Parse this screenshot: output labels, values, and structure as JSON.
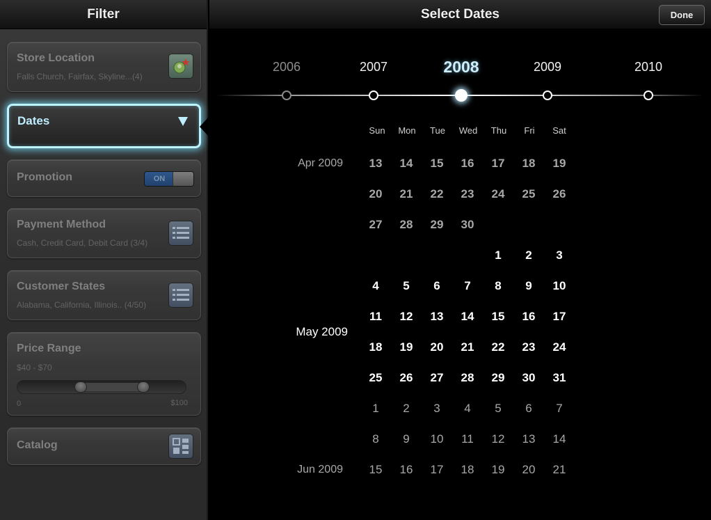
{
  "left": {
    "title": "Filter",
    "cards": {
      "store": {
        "title": "Store Location",
        "sub": "Falls Church, Fairfax, Skyline...(4)",
        "icon": "map-pin-icon"
      },
      "dates": {
        "title": "Dates",
        "icon": "triangle-down-icon"
      },
      "promotion": {
        "title": "Promotion",
        "toggle": "ON"
      },
      "payment": {
        "title": "Payment Method",
        "sub": "Cash, Credit Card, Debit Card (3/4)",
        "icon": "list-icon"
      },
      "states": {
        "title": "Customer States",
        "sub": "Alabama, California, Illinois.. (4/50)",
        "icon": "list-icon"
      },
      "price": {
        "title": "Price Range",
        "sub": "$40 - $70",
        "min": "0",
        "max": "$100"
      },
      "catalog": {
        "title": "Catalog",
        "icon": "catalog-icon"
      }
    }
  },
  "right": {
    "title": "Select Dates",
    "done": "Done",
    "years": [
      "2006",
      "2007",
      "2008",
      "2009",
      "2010"
    ],
    "selected_year": "2008",
    "weekdays": [
      "Sun",
      "Mon",
      "Tue",
      "Wed",
      "Thu",
      "Fri",
      "Sat"
    ],
    "months": [
      "Apr 2009",
      "May 2009",
      "Jun 2009"
    ],
    "weeks": [
      [
        "13",
        "14",
        "15",
        "16",
        "17",
        "18",
        "19"
      ],
      [
        "20",
        "21",
        "22",
        "23",
        "24",
        "25",
        "26"
      ],
      [
        "27",
        "28",
        "29",
        "30",
        "",
        "",
        ""
      ],
      [
        "",
        "",
        "",
        "",
        "1",
        "2",
        "3"
      ],
      [
        "4",
        "5",
        "6",
        "7",
        "8",
        "9",
        "10"
      ],
      [
        "11",
        "12",
        "13",
        "14",
        "15",
        "16",
        "17"
      ],
      [
        "18",
        "19",
        "20",
        "21",
        "22",
        "23",
        "24"
      ],
      [
        "25",
        "26",
        "27",
        "28",
        "29",
        "30",
        "31"
      ],
      [
        "1",
        "2",
        "3",
        "4",
        "5",
        "6",
        "7"
      ],
      [
        "8",
        "9",
        "10",
        "11",
        "12",
        "13",
        "14"
      ],
      [
        "15",
        "16",
        "17",
        "18",
        "19",
        "20",
        "21"
      ]
    ]
  }
}
